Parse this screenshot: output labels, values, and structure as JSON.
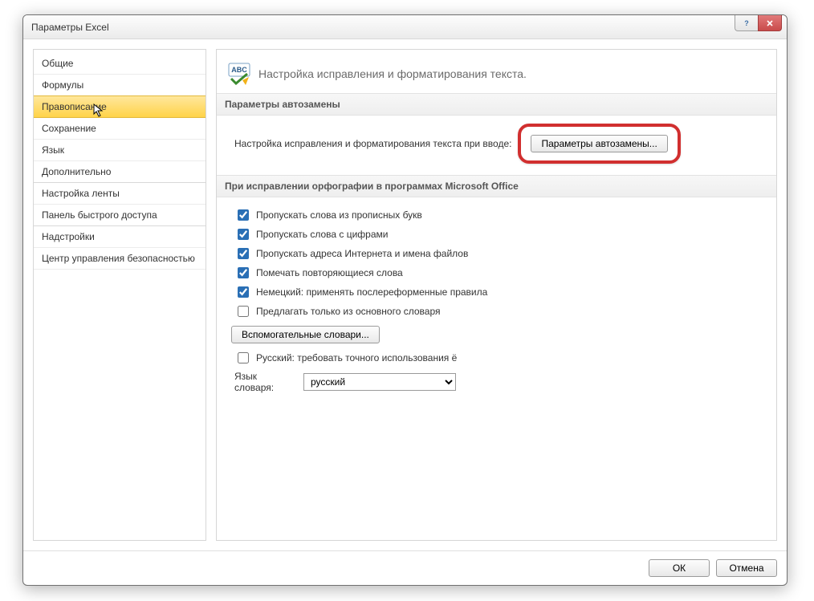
{
  "window": {
    "title": "Параметры Excel"
  },
  "sidebar": {
    "items": [
      {
        "label": "Общие"
      },
      {
        "label": "Формулы"
      },
      {
        "label": "Правописание",
        "selected": true
      },
      {
        "label": "Сохранение"
      },
      {
        "label": "Язык"
      },
      {
        "label": "Дополнительно"
      },
      {
        "label": "Настройка ленты"
      },
      {
        "label": "Панель быстрого доступа"
      },
      {
        "label": "Надстройки"
      },
      {
        "label": "Центр управления безопасностью"
      }
    ]
  },
  "main": {
    "header_text": "Настройка исправления и форматирования текста.",
    "sections": {
      "autocorrect": {
        "title": "Параметры автозамены",
        "desc": "Настройка исправления и форматирования текста при вводе:",
        "button": "Параметры автозамены..."
      },
      "spelling": {
        "title": "При исправлении орфографии в программах Microsoft Office",
        "options": [
          {
            "label": "Пропускать слова из прописных букв",
            "checked": true
          },
          {
            "label": "Пропускать слова с цифрами",
            "checked": true
          },
          {
            "label": "Пропускать адреса Интернета и имена файлов",
            "checked": true
          },
          {
            "label": "Помечать повторяющиеся слова",
            "checked": true
          },
          {
            "label": "Немецкий: применять послереформенные правила",
            "checked": true
          },
          {
            "label": "Предлагать только из основного словаря",
            "checked": false
          }
        ],
        "aux_dicts_button": "Вспомогательные словари...",
        "russian_yo": {
          "label": "Русский: требовать точного использования ё",
          "checked": false
        },
        "dict_lang_label": "Язык словаря:",
        "dict_lang_value": "русский"
      }
    }
  },
  "footer": {
    "ok": "ОК",
    "cancel": "Отмена"
  }
}
